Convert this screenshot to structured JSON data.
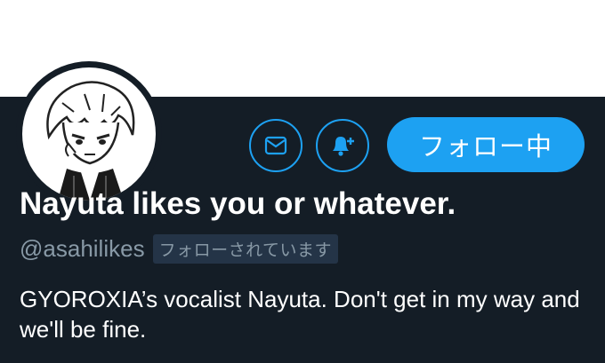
{
  "profile": {
    "display_name": "Nayuta likes you or whatever.",
    "handle": "@asahilikes",
    "follows_you_label": "フォローされています",
    "bio": "GYOROXIA’s vocalist Nayuta. Don't get in my way and we'll be fine."
  },
  "actions": {
    "follow_label": "フォロー中",
    "dm_icon": "envelope-icon",
    "notify_icon": "bell-plus-icon"
  },
  "colors": {
    "accent": "#1da1f2",
    "background": "#141d26",
    "muted_text": "#8899a6"
  }
}
